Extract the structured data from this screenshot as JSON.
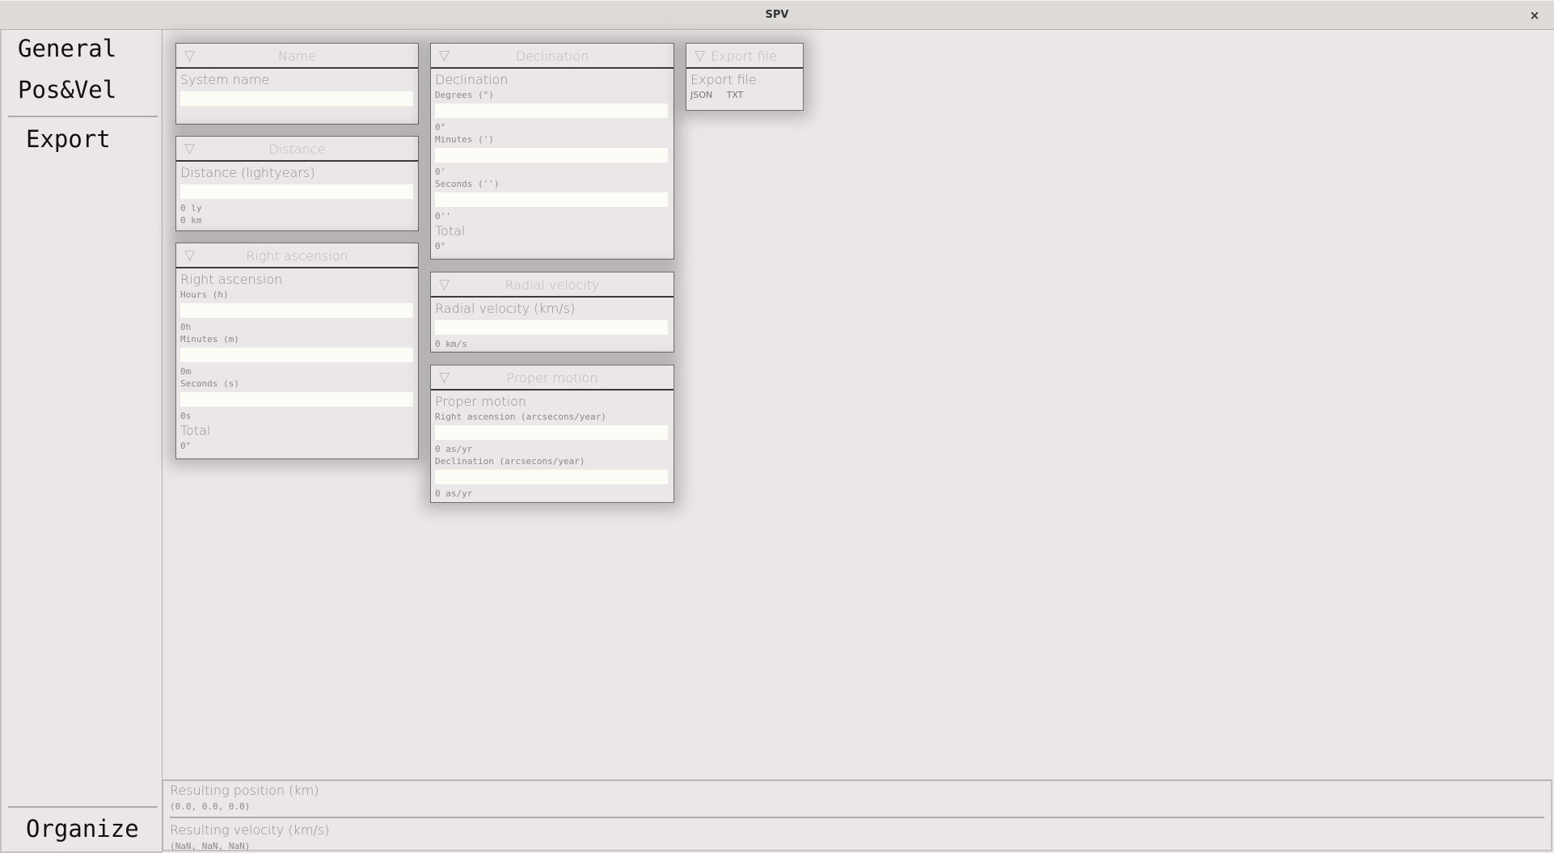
{
  "window": {
    "title": "SPV",
    "close_icon": "×"
  },
  "sidebar": {
    "items": [
      {
        "label": "General"
      },
      {
        "label": "Pos&Vel"
      },
      {
        "label": "Export"
      }
    ],
    "bottom_item": {
      "label": "Organize"
    }
  },
  "panels": {
    "name": {
      "title": "Name",
      "collapse_icon": "▽",
      "section": "System name",
      "input_value": ""
    },
    "distance": {
      "title": "Distance",
      "collapse_icon": "▽",
      "section": "Distance (lightyears)",
      "input_value": "",
      "readouts": [
        "0 ly",
        "0 km"
      ]
    },
    "right_ascension": {
      "title": "Right ascension",
      "collapse_icon": "▽",
      "section": "Right ascension",
      "fields": [
        {
          "label": "Hours (h)",
          "value": "",
          "readout": "0h"
        },
        {
          "label": "Minutes (m)",
          "value": "",
          "readout": "0m"
        },
        {
          "label": "Seconds (s)",
          "value": "",
          "readout": "0s"
        }
      ],
      "total_label": "Total",
      "total_value": "0°"
    },
    "declination": {
      "title": "Declination",
      "collapse_icon": "▽",
      "section": "Declination",
      "fields": [
        {
          "label": "Degrees (°)",
          "value": "",
          "readout": "0°"
        },
        {
          "label": "Minutes (')",
          "value": "",
          "readout": "0'"
        },
        {
          "label": "Seconds ('')",
          "value": "",
          "readout": "0''"
        }
      ],
      "total_label": "Total",
      "total_value": "0°"
    },
    "radial_velocity": {
      "title": "Radial velocity",
      "collapse_icon": "▽",
      "section": "Radial velocity (km/s)",
      "input_value": "",
      "readout": "0 km/s"
    },
    "proper_motion": {
      "title": "Proper motion",
      "collapse_icon": "▽",
      "section": "Proper motion",
      "fields": [
        {
          "label": "Right ascension (arcsecons/year)",
          "value": "",
          "readout": "0 as/yr"
        },
        {
          "label": "Declination (arcsecons/year)",
          "value": "",
          "readout": "0 as/yr"
        }
      ]
    },
    "export_file": {
      "title": "Export file",
      "collapse_icon": "▽",
      "section": "Export file",
      "options": [
        "JSON",
        "TXT"
      ]
    }
  },
  "results": {
    "position_label": "Resulting position (km)",
    "position_value": "(0.0, 0.0, 0.0)",
    "velocity_label": "Resulting velocity (km/s)",
    "velocity_value": "(NaN, NaN, NaN)"
  }
}
